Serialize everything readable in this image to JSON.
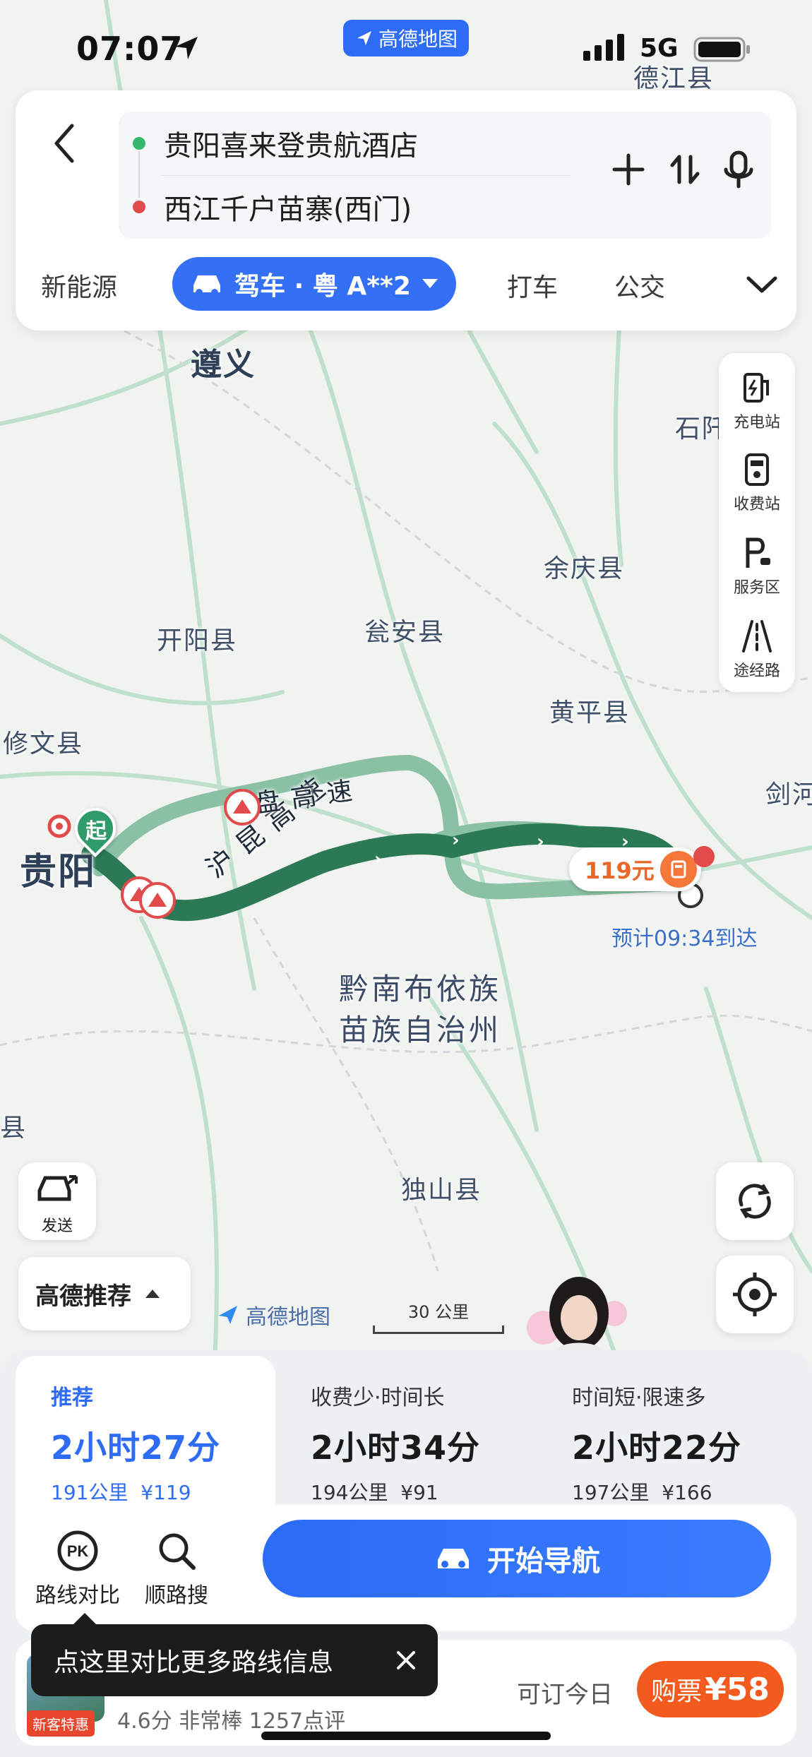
{
  "status_bar": {
    "time": "07:07",
    "network": "5G"
  },
  "app_badge": "高德地图",
  "route": {
    "origin": "贵阳喜来登贵航酒店",
    "destination": "西江千户苗寨(西门)"
  },
  "modes": {
    "new_energy": "新能源",
    "drive": "驾车 · 粤 A**2",
    "taxi": "打车",
    "transit": "公交"
  },
  "map_labels": {
    "dejiang": "德江县",
    "zunyi": "遵义",
    "shiqian": "石阡",
    "yuqing": "余庆县",
    "kaiyang": "开阳县",
    "wengan": "瓮安县",
    "huangping": "黄平县",
    "xiuwen": "修文县",
    "jianhe": "剑河",
    "guiyang": "贵阳",
    "qiannan_line1": "黔南布依族",
    "qiannan_line2": "苗族自治州",
    "dushan": "独山县",
    "left_edge": "县",
    "road1": "沪 昆 高 速",
    "road2": "盘 高 速"
  },
  "map_markers": {
    "start": "起",
    "toll_price": "119元",
    "eta": "预计09:34到达"
  },
  "right_toolbar": [
    {
      "label": "充电站",
      "icon": "charging-station-icon"
    },
    {
      "label": "收费站",
      "icon": "toll-station-icon"
    },
    {
      "label": "服务区",
      "icon": "service-area-icon"
    },
    {
      "label": "途经路",
      "icon": "via-road-icon"
    }
  ],
  "send_label": "发送",
  "recommend_dropdown": "高德推荐",
  "watermark": "高德地图",
  "scale_label": "30 公里",
  "route_options": [
    {
      "tag": "推荐",
      "duration": "2小时27分",
      "distance": "191公里",
      "cost": "¥119"
    },
    {
      "tag": "收费少·时间长",
      "duration": "2小时34分",
      "distance": "194公里",
      "cost": "¥91"
    },
    {
      "tag": "时间短·限速多",
      "duration": "2小时22分",
      "distance": "197公里",
      "cost": "¥166"
    }
  ],
  "actions": {
    "compare": "路线对比",
    "along_search": "顺路搜",
    "start_nav": "开始导航"
  },
  "hotel_bar": {
    "rating": "4.6分 非常棒 1257点评",
    "availability": "可订今日",
    "buy_label": "购票",
    "price": "¥58",
    "new_badge": "新客特惠"
  },
  "tooltip": "点这里对比更多路线信息",
  "colors": {
    "accent": "#2f6cf5",
    "route_main": "#2b7a55",
    "route_alt": "#8ac0a4",
    "buy": "#f25a1e"
  }
}
